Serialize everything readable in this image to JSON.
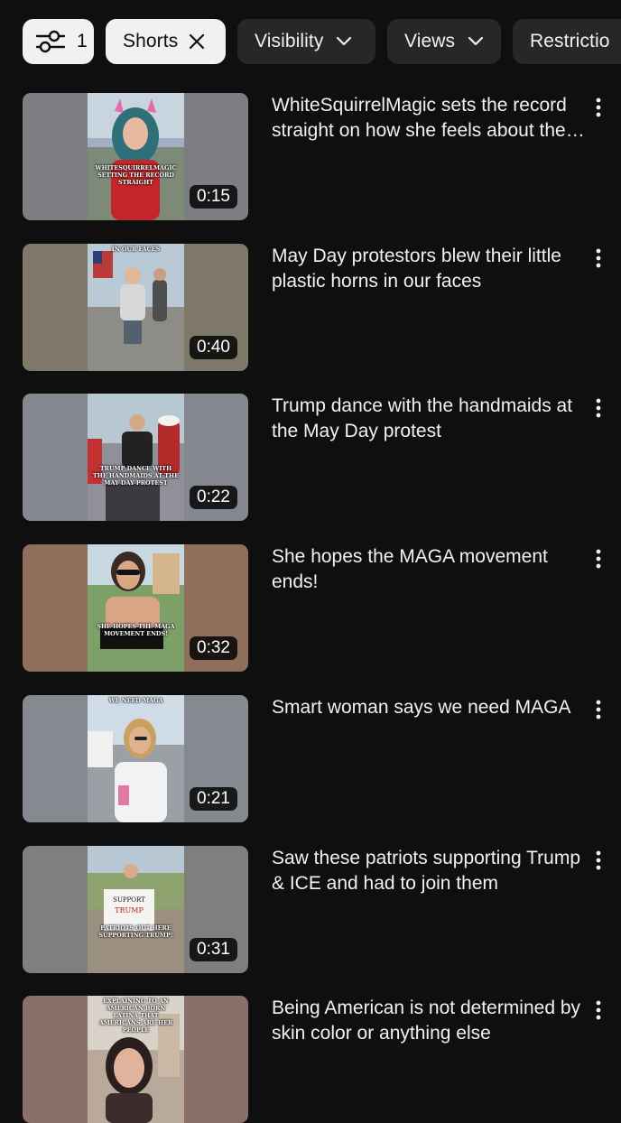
{
  "filters": {
    "count": "1",
    "shorts_label": "Shorts",
    "visibility_label": "Visibility",
    "views_label": "Views",
    "restrictions_label": "Restrictio"
  },
  "videos": [
    {
      "title": "WhiteSquirrelMagic sets the record straight on how she feels about the trolls and hate",
      "duration": "0:15",
      "caption": "WhiteSquirrelMagic setting the record straight",
      "side_color": "#7c7e84",
      "scene": "woman-pink-hair"
    },
    {
      "title": "May Day protestors blew their little plastic horns in our faces",
      "duration": "0:40",
      "caption": "in our faces",
      "side_color": "#7d7867",
      "scene": "street-man"
    },
    {
      "title": "Trump dance with the handmaids at the May Day protest",
      "duration": "0:22",
      "caption": "Trump dance with the handmaids at the May Day protest",
      "side_color": "#858890",
      "scene": "crowd"
    },
    {
      "title": "She hopes the MAGA movement ends!",
      "duration": "0:32",
      "caption": "She hopes the MAGA movement ends!",
      "side_color": "#8f6e5c",
      "scene": "woman-sunglasses"
    },
    {
      "title": "Smart woman says we need MAGA",
      "duration": "0:21",
      "caption": "we need MAGA",
      "side_color": "#868990",
      "scene": "woman-blonde"
    },
    {
      "title": "Saw these patriots supporting Trump & ICE and had to join them",
      "duration": "0:31",
      "caption": "Patriots out here supporting Trump!",
      "side_color": "#7f7f7d",
      "scene": "sign"
    },
    {
      "title": "Being American is not determined by skin color or anything else",
      "duration": "",
      "caption": "Explaining to an American born Latina that Americans are her people",
      "side_color": "#8a6f6a",
      "scene": "woman-dark-hair"
    }
  ]
}
